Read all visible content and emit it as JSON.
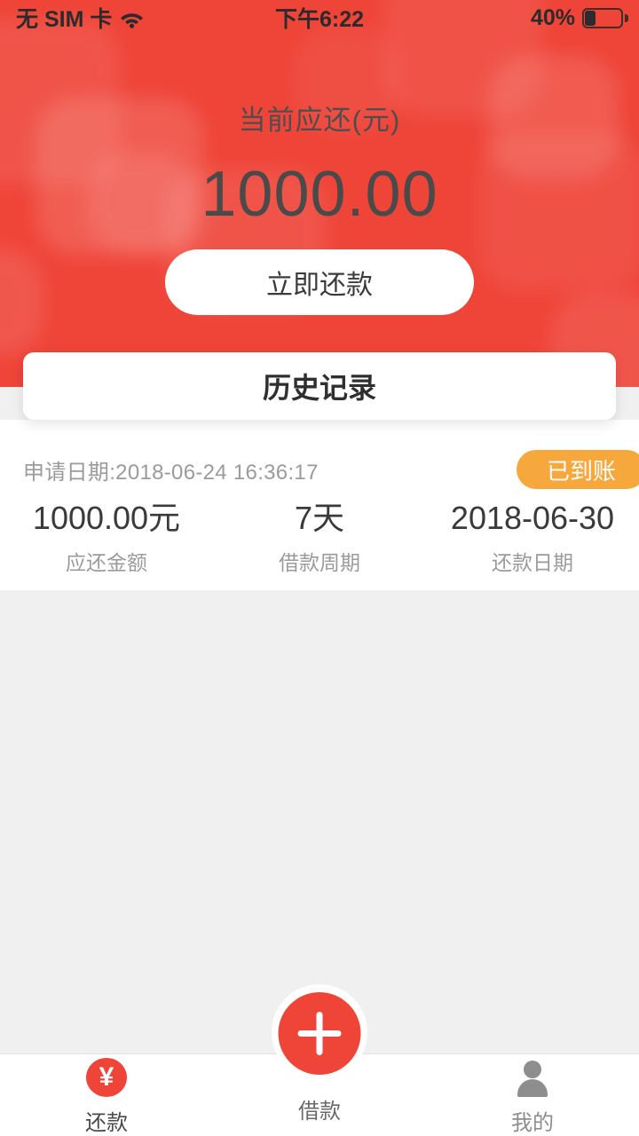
{
  "status_bar": {
    "carrier": "无 SIM 卡",
    "wifi_icon": "wifi-icon",
    "time": "下午6:22",
    "battery_percent": "40%",
    "battery_icon": "battery-icon",
    "battery_level": 40
  },
  "hero": {
    "label": "当前应还(元)",
    "amount": "1000.00",
    "repay_button": "立即还款",
    "background_color": "#ef4438",
    "text_color": "#4a4a4a"
  },
  "history": {
    "title": "历史记录",
    "record": {
      "apply_date": "申请日期:2018-06-24 16:36:17",
      "status_badge": "已到账",
      "status_badge_color": "#f6a83d",
      "columns": [
        {
          "value": "1000.00元",
          "label": "应还金额"
        },
        {
          "value": "7天",
          "label": "借款周期"
        },
        {
          "value": "2018-06-30",
          "label": "还款日期"
        }
      ]
    }
  },
  "tabbar": {
    "items": [
      {
        "label": "还款",
        "icon": "yuan-circle-icon",
        "active": true
      },
      {
        "label": "借款",
        "icon": "plus-icon",
        "active": false
      },
      {
        "label": "我的",
        "icon": "person-icon",
        "active": false
      }
    ],
    "accent_color": "#ef4438"
  }
}
